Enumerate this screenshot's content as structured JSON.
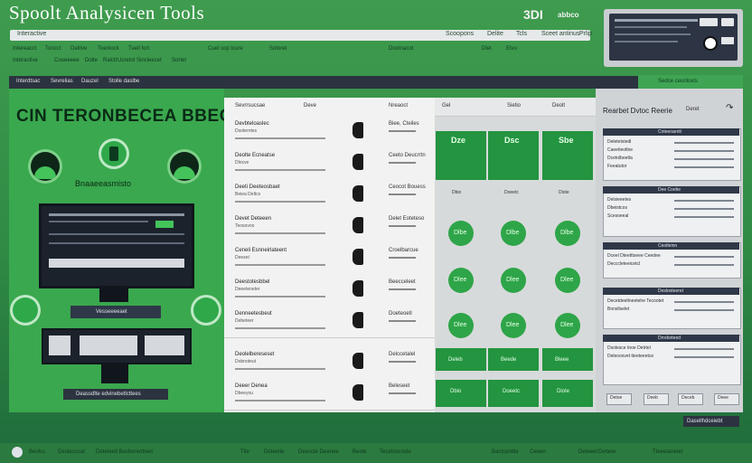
{
  "app": {
    "title": "Spoolt Analysicen Tools",
    "header_right_a": "3DI",
    "header_right_b": "abbco"
  },
  "menu": [
    "Interactive",
    "Scoopons",
    "Delite",
    "Tcls",
    "Sceet antinus",
    "Prlip"
  ],
  "subtoolbar": [
    "Intereacct",
    "Toncct",
    "Delitve",
    "Toenlock",
    "Tuell fort",
    "Cuel cop tcure",
    "Sotoret",
    "Dootnacot",
    "Diet",
    "Etvo"
  ],
  "subtoolbar2": [
    "Interactive",
    "Cooeeeee",
    "Dolte",
    "Ralctt",
    "Ucretot Sincleecet",
    "Sortet"
  ],
  "nav": [
    "Interdtsac",
    "Sevrelias",
    "Dauzel",
    "Stolle daslbe"
  ],
  "nav_button": "Sedce ceurilcels",
  "left": {
    "big_title": "CIN TERONBECEA BBEC",
    "subtitle": "Bnaaeeasmisto",
    "panel_btn_label": "Vesseeeeaet",
    "bottom_label": "Deassdlte edvinebetlcttees"
  },
  "table_head": [
    "Sevrrsucsae",
    "Deve",
    "Nreaoct",
    "Gel",
    "Sietio",
    "Deolt"
  ],
  "rows": [
    {
      "a": "Devbteloaslec",
      "b": "Dsoterntes",
      "c": "Biee, Cteiles"
    },
    {
      "a": "Deolte Ecneatse",
      "b": "Dlncve",
      "c": "Ceeto Deucrrtn"
    },
    {
      "a": "Deeti Deeteosbaet",
      "b": "Beiea Deltcs",
      "c": "Ceocot Bouess"
    },
    {
      "a": "Devet Deteeen",
      "b": "Teosovoo",
      "c": "Delet Eoteteso"
    },
    {
      "a": "Ceneli Esnneirlateent",
      "b": "Deeset",
      "c": "Croelbarcue"
    },
    {
      "a": "Deestotesbbel",
      "b": "Deeeteneter",
      "c": "Beecceleet"
    },
    {
      "a": "Denneetesbeut",
      "b": "Debeteer",
      "c": "Doeteoetl"
    },
    {
      "a": "Deolelbereseset",
      "b": "Dobnoteut",
      "c": "Delccetalel"
    },
    {
      "a": "Deeer Denea",
      "b": "Dbeeyou",
      "c": "Beleseet"
    }
  ],
  "grid_badges": [
    "Dze",
    "Dsc",
    "Sbe",
    "Dlbe",
    "Dlee",
    "Dlee",
    "Dttse",
    "Dce"
  ],
  "grid_btns": [
    "Deleb",
    "Beede",
    "Bleee"
  ],
  "grid_small": [
    "Dbio",
    "Doeetc",
    "Diote",
    "Dteoc",
    "Seede",
    "Dlcce"
  ],
  "right": {
    "head": "Rearbet Dvtoc Reerie",
    "head_btns": [
      "Deret"
    ],
    "cards": [
      {
        "title": "Cnteeraenlt",
        "lines": [
          "Deletetstedl",
          "Caeetieotlne",
          "Dcetolbeetla",
          "Feeatutor"
        ]
      },
      {
        "title": "Dee Coetie",
        "lines": [
          "Delsieeetes",
          "Dbeistcos",
          "Scesoeeal"
        ]
      },
      {
        "title": "Ceotleinn",
        "lines": [
          "Dceel Dteetttseee Ceedee",
          "Decccleteeicetcl"
        ]
      },
      {
        "title": "Deslosteeret",
        "lines": [
          "Decetdeeltneetehe Tecootet",
          "Bonsllselet"
        ]
      },
      {
        "title": "Drreboteed",
        "lines": [
          "Dsolesce tnoe Detrtel",
          "Deleoosvet tteeteeetce"
        ]
      }
    ],
    "card_btns": [
      "Detoe",
      "Deeb",
      "Deceb",
      "Deee"
    ],
    "bottom_btn": "Dasellhdceiebt"
  },
  "footer": [
    "Beolcs",
    "Deutesscal",
    "Deteteetl Besbereotteet",
    "Tlte",
    "Deteetle",
    "Deescte Deenee",
    "Beole",
    "Tecetcecosle",
    "Bactcenttle",
    "Ceeen",
    "Deteeet",
    "Dettete",
    "Tteeetaneiet"
  ]
}
